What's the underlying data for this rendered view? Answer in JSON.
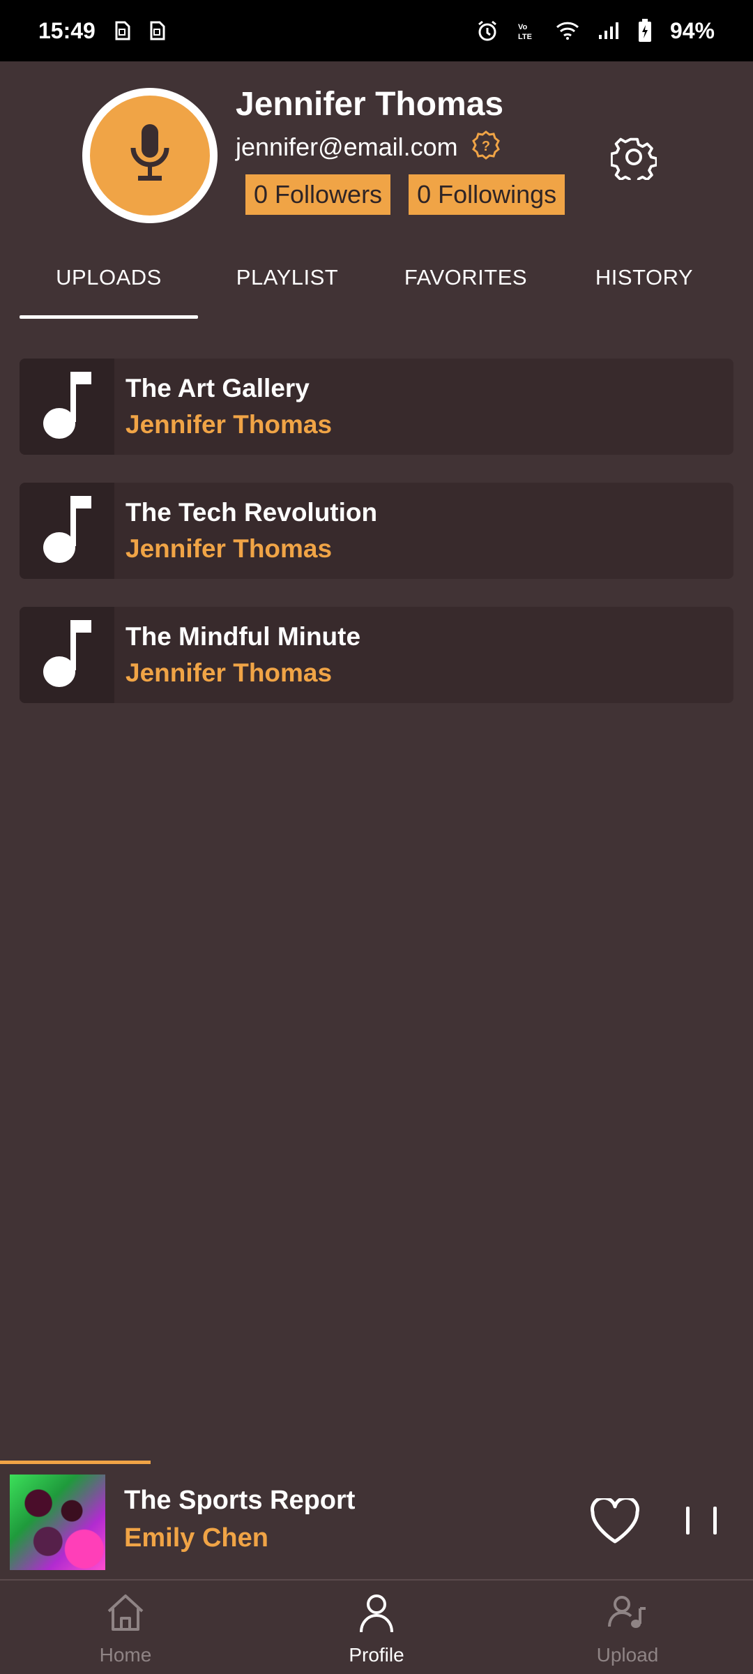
{
  "status_bar": {
    "time": "15:49",
    "battery": "94%",
    "left_icons": [
      "sim-icon",
      "sim-icon"
    ],
    "right_icons": [
      "alarm-icon",
      "volte-icon",
      "wifi-icon",
      "signal-icon",
      "battery-icon"
    ]
  },
  "profile": {
    "name": "Jennifer Thomas",
    "email": "jennifer@email.com",
    "followers": "0 Followers",
    "followings": "0 Followings",
    "avatar_icon": "microphone-icon",
    "verify_icon": "help-badge-icon",
    "settings_icon": "gear-icon"
  },
  "tabs": [
    {
      "label": "UPLOADS",
      "active": true
    },
    {
      "label": "PLAYLIST",
      "active": false
    },
    {
      "label": "FAVORITES",
      "active": false
    },
    {
      "label": "HISTORY",
      "active": false
    }
  ],
  "uploads": [
    {
      "title": "The Art Gallery",
      "artist": "Jennifer Thomas"
    },
    {
      "title": "The Tech Revolution",
      "artist": "Jennifer Thomas"
    },
    {
      "title": "The Mindful Minute",
      "artist": "Jennifer Thomas"
    }
  ],
  "now_playing": {
    "title": "The Sports Report",
    "artist": "Emily Chen",
    "progress": 0.2
  },
  "bottom_nav": [
    {
      "label": "Home",
      "icon": "home-icon",
      "active": false
    },
    {
      "label": "Profile",
      "icon": "person-icon",
      "active": true
    },
    {
      "label": "Upload",
      "icon": "upload-user-icon",
      "active": false
    }
  ],
  "colors": {
    "background": "#413335",
    "accent": "#f0a446",
    "card": "#382a2c"
  }
}
